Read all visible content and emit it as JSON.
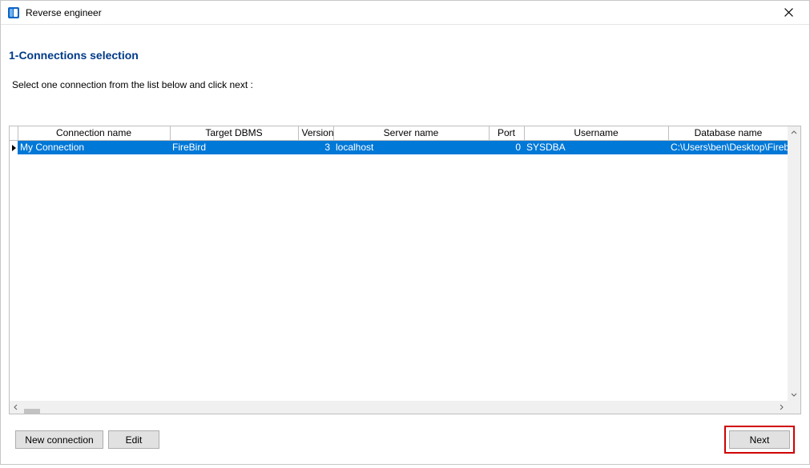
{
  "window": {
    "title": "Reverse engineer"
  },
  "header": {
    "step_title": "1-Connections selection",
    "instruction": "Select one connection from the list below and click next :"
  },
  "grid": {
    "columns": {
      "name": "Connection name",
      "dbms": "Target DBMS",
      "version": "Version",
      "server": "Server name",
      "port": "Port",
      "user": "Username",
      "db": "Database name"
    },
    "rows": [
      {
        "name": "My Connection",
        "dbms": "FireBird",
        "version": "3",
        "server": "localhost",
        "port": "0",
        "user": "SYSDBA",
        "db": "C:\\Users\\ben\\Desktop\\FirebirdDataba",
        "selected": true
      }
    ]
  },
  "buttons": {
    "new_connection": "New connection",
    "edit": "Edit",
    "next": "Next"
  }
}
